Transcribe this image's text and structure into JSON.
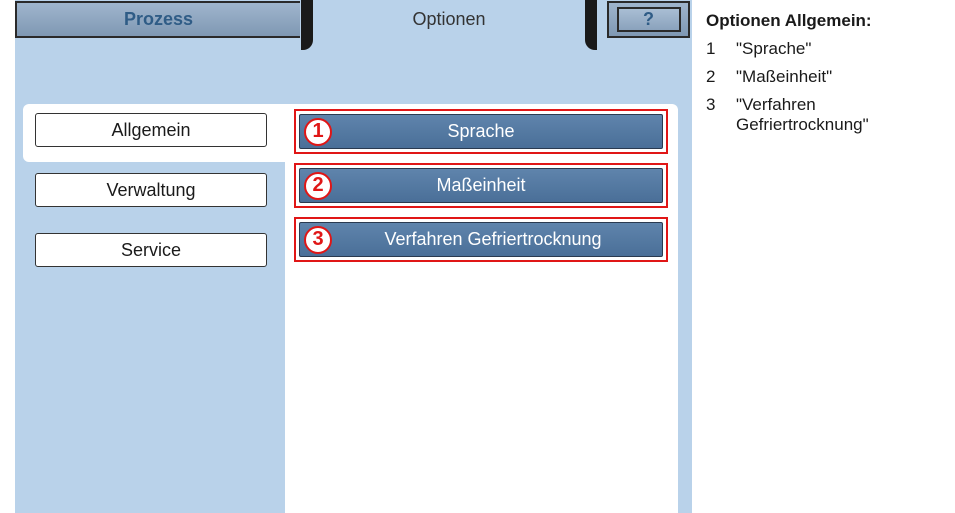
{
  "tabs": {
    "prozess": "Prozess",
    "optionen": "Optionen",
    "help": "?"
  },
  "categories": [
    "Allgemein",
    "Verwaltung",
    "Service"
  ],
  "options": [
    {
      "number": "1",
      "label": "Sprache"
    },
    {
      "number": "2",
      "label": "Maßeinheit"
    },
    {
      "number": "3",
      "label": "Verfahren Gefriertrocknung"
    }
  ],
  "legend": {
    "title": "Optionen Allgemein:",
    "items": [
      {
        "number": "1",
        "text": "\"Sprache\""
      },
      {
        "number": "2",
        "text": "\"Maßeinheit\""
      },
      {
        "number": "3",
        "text": "\"Verfahren Gefriertrocknung\""
      }
    ]
  },
  "colors": {
    "panel_bg": "#b9d2ea",
    "button_blue": "#557aa3",
    "highlight_red": "#e01616",
    "tab_text": "#2f5c86"
  }
}
